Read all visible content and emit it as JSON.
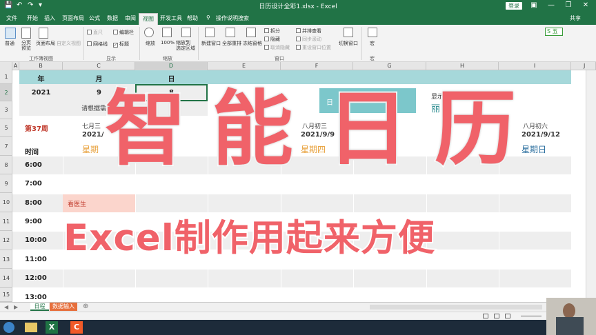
{
  "window": {
    "title": "日历设计全彩1.xlsx - Excel",
    "login": "登录",
    "share": "共享"
  },
  "tabs": [
    "文件",
    "开始",
    "插入",
    "页面布局",
    "公式",
    "数据",
    "审阅",
    "视图",
    "开发工具",
    "帮助",
    "操作说明搜索"
  ],
  "ribbon": {
    "views": {
      "normal": "普通",
      "page_break": "分页\n预览",
      "page_layout": "页面布局",
      "custom": "自定义视图",
      "group": "工作簿视图"
    },
    "show": {
      "ruler": "直尺",
      "formula_bar": "编辑栏",
      "gridlines": "网格线",
      "headings": "标题",
      "group": "显示"
    },
    "zoom": {
      "zoom": "缩放",
      "hundred": "100%",
      "to_selection": "缩放到\n选定区域",
      "group": "缩放"
    },
    "window": {
      "new_window": "新建窗口",
      "arrange_all": "全部重排",
      "freeze": "冻结窗格",
      "split": "拆分",
      "hide": "隐藏",
      "unhide": "取消隐藏",
      "side_by_side": "并排查看",
      "sync_scroll": "同步滚动",
      "reset_pos": "重设窗口位置",
      "switch": "切换窗口",
      "group": "窗口"
    },
    "macros": {
      "macros": "宏",
      "group": "宏"
    }
  },
  "columns": [
    "A",
    "B",
    "C",
    "D",
    "E",
    "F",
    "G",
    "H",
    "I",
    "J"
  ],
  "rows": [
    "1",
    "2",
    "3",
    "5",
    "7",
    "8",
    "9",
    "10",
    "11",
    "12",
    "13",
    "14",
    "15"
  ],
  "sheet": {
    "header_year": "年",
    "header_month": "月",
    "header_day": "日",
    "year": "2021",
    "month": "9",
    "day": "8",
    "hint": "请根据需",
    "btn_label": "日",
    "display_label": "显示",
    "display_value": "丽",
    "week": "第37周",
    "time_label": "时间",
    "lunar": [
      "七月三",
      "八月初三",
      "八月初六"
    ],
    "dates": [
      "2021/",
      "2021/9/9",
      "2021/9/12"
    ],
    "weekdays": [
      "星期",
      "星期四",
      "星期日"
    ],
    "times": [
      "6:00",
      "7:00",
      "8:00",
      "9:00",
      "10:00",
      "11:00",
      "12:00",
      "13:00"
    ],
    "event": "看医生"
  },
  "sheet_tabs": [
    "日程",
    "数据输入"
  ],
  "overlay": {
    "chars": [
      "智",
      "能",
      "日",
      "历"
    ],
    "subtitle": "Excel制作用起来方便"
  },
  "colors": {
    "excel_green": "#217346",
    "teal": "#a6d8da",
    "overlay_red": "#f06269",
    "event_bg": "#fbd5cc"
  }
}
